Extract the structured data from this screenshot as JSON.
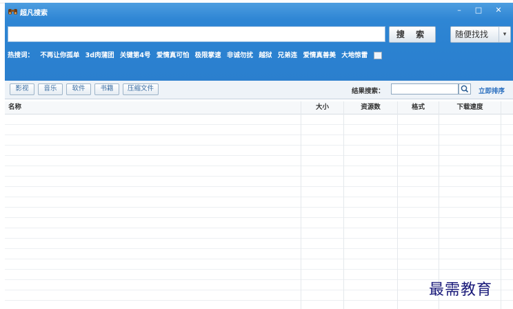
{
  "window": {
    "title": "超凡搜索",
    "controls": [
      "–",
      "□",
      "✕"
    ]
  },
  "search": {
    "value": "",
    "button_label": "搜 索",
    "random_label": "随便找找",
    "random_arrow": "▾"
  },
  "hot": {
    "label": "热搜词：",
    "items": [
      "不再让你孤单",
      "3d肉蒲团",
      "关键第4号",
      "爱情真可怕",
      "极限掌速",
      "非诚勿扰",
      "越狱",
      "兄弟连",
      "爱情真善美",
      "大地惊雷"
    ]
  },
  "categories": [
    "影视",
    "音乐",
    "软件",
    "书籍",
    "压缩文件"
  ],
  "filter": {
    "label": "结果搜索：",
    "value": "",
    "sort_label": "立即排序"
  },
  "table": {
    "columns": [
      "名称",
      "大小",
      "资源数",
      "格式",
      "下载速度"
    ]
  },
  "watermark": "最需教育",
  "colors": {
    "header_blue": "#2f86d4",
    "link_blue": "#2a6fbf",
    "watermark": "#1a1a7a"
  }
}
